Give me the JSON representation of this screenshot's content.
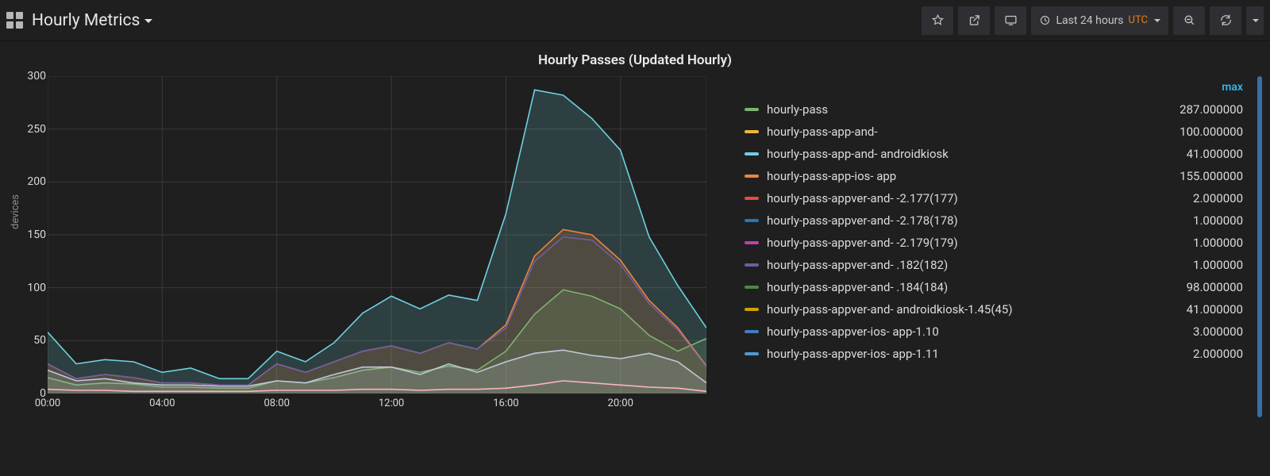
{
  "header": {
    "dashboard_title": "Hourly Metrics",
    "time_range": "Last 24 hours",
    "timezone": "UTC"
  },
  "panel": {
    "title": "Hourly Passes (Updated Hourly)",
    "ylabel": "devices"
  },
  "legend": {
    "header": "max",
    "rows": [
      {
        "color": "#7eb26d",
        "name": "hourly-pass",
        "max": "287.000000"
      },
      {
        "color": "#eab839",
        "name": "hourly-pass-app-and-",
        "max": "100.000000"
      },
      {
        "color": "#6ed0e0",
        "name": "hourly-pass-app-and-                          androidkiosk",
        "max": "41.000000"
      },
      {
        "color": "#ef843c",
        "name": "hourly-pass-app-ios-                               app",
        "max": "155.000000"
      },
      {
        "color": "#e24d42",
        "name": "hourly-pass-appver-and-                       -2.177(177)",
        "max": "2.000000"
      },
      {
        "color": "#1f78c1",
        "name": "hourly-pass-appver-and-                       -2.178(178)",
        "max": "1.000000"
      },
      {
        "color": "#ba43a9",
        "name": "hourly-pass-appver-and-                       -2.179(179)",
        "max": "1.000000"
      },
      {
        "color": "#705da0",
        "name": "hourly-pass-appver-and-                       .182(182)",
        "max": "1.000000"
      },
      {
        "color": "#508642",
        "name": "hourly-pass-appver-and-                       .184(184)",
        "max": "98.000000"
      },
      {
        "color": "#cca300",
        "name": "hourly-pass-appver-and-                       androidkiosk-1.45(45)",
        "max": "41.000000"
      },
      {
        "color": "#447ebc",
        "name": "hourly-pass-appver-ios-                        app-1.10",
        "max": "3.000000"
      },
      {
        "color": "#5195ce",
        "name": "hourly-pass-appver-ios-                        app-1.11",
        "max": "2.000000"
      }
    ]
  },
  "chart_data": {
    "type": "area",
    "title": "Hourly Passes (Updated Hourly)",
    "xlabel": "",
    "ylabel": "devices",
    "ylim": [
      0,
      300
    ],
    "x_ticks": [
      "00:00",
      "04:00",
      "08:00",
      "12:00",
      "16:00",
      "20:00"
    ],
    "y_ticks": [
      0,
      50,
      100,
      150,
      200,
      250,
      300
    ],
    "categories": [
      "00:00",
      "01:00",
      "02:00",
      "03:00",
      "04:00",
      "05:00",
      "06:00",
      "07:00",
      "08:00",
      "09:00",
      "10:00",
      "11:00",
      "12:00",
      "13:00",
      "14:00",
      "15:00",
      "16:00",
      "17:00",
      "18:00",
      "19:00",
      "20:00",
      "21:00",
      "22:00",
      "23:00"
    ],
    "series": [
      {
        "name": "hourly-pass",
        "color": "#6ed0e0",
        "fill": true,
        "values": [
          58,
          28,
          32,
          30,
          20,
          24,
          14,
          14,
          40,
          30,
          48,
          76,
          92,
          80,
          93,
          88,
          170,
          287,
          282,
          260,
          230,
          148,
          102,
          62
        ]
      },
      {
        "name": "hourly-pass-app-ios-app",
        "color": "#ef843c",
        "fill": true,
        "values": [
          28,
          14,
          18,
          15,
          10,
          10,
          8,
          8,
          28,
          20,
          30,
          40,
          45,
          38,
          48,
          42,
          65,
          130,
          155,
          150,
          126,
          88,
          62,
          26
        ]
      },
      {
        "name": "hourly-pass-appver-and-.184(184)",
        "color": "#7eb26d",
        "fill": true,
        "values": [
          15,
          8,
          10,
          9,
          6,
          6,
          5,
          5,
          12,
          10,
          15,
          22,
          25,
          20,
          26,
          22,
          40,
          75,
          98,
          92,
          80,
          55,
          40,
          52
        ]
      },
      {
        "name": "hourly-pass-app-and-androidkiosk",
        "color": "#bfc7d9",
        "fill": true,
        "values": [
          22,
          12,
          14,
          10,
          8,
          8,
          7,
          7,
          12,
          10,
          18,
          25,
          25,
          18,
          28,
          20,
          30,
          38,
          41,
          36,
          33,
          38,
          30,
          10
        ]
      },
      {
        "name": "hourly-pass-appver-and-.182(182)",
        "color": "#705da0",
        "fill": false,
        "values": [
          28,
          14,
          18,
          15,
          10,
          10,
          8,
          8,
          28,
          20,
          30,
          40,
          45,
          38,
          48,
          42,
          62,
          125,
          148,
          145,
          122,
          85,
          60,
          25
        ]
      },
      {
        "name": "hourly-pass-appver-and-2.177(177)",
        "color": "#ffb3c6",
        "fill": false,
        "values": [
          4,
          3,
          3,
          2,
          2,
          2,
          2,
          2,
          3,
          3,
          3,
          4,
          4,
          3,
          4,
          4,
          5,
          8,
          12,
          10,
          8,
          6,
          5,
          2
        ]
      }
    ]
  }
}
